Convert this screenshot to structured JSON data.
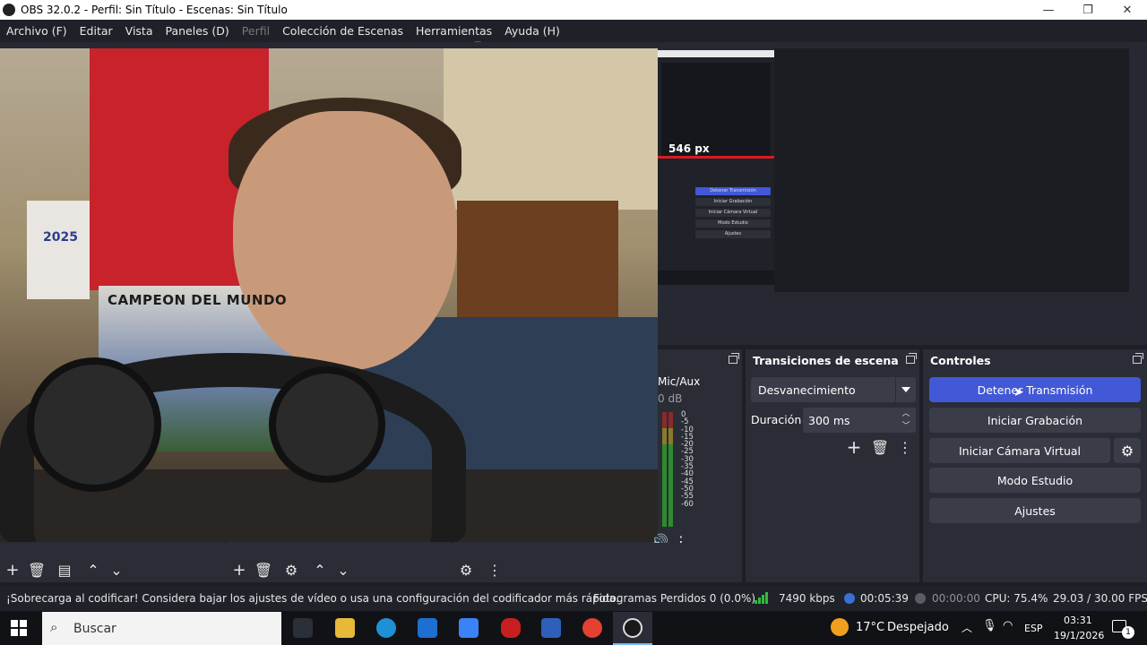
{
  "window": {
    "title": "OBS 32.0.2 - Perfil: Sin Título - Escenas: Sin Título",
    "minimize": "—",
    "restore": "❐",
    "close": "✕"
  },
  "menu": [
    {
      "label": "Archivo (F)",
      "enabled": true
    },
    {
      "label": "Editar",
      "enabled": true
    },
    {
      "label": "Vista",
      "enabled": true
    },
    {
      "label": "Paneles (D)",
      "enabled": true
    },
    {
      "label": "Perfil",
      "enabled": false
    },
    {
      "label": "Colección de Escenas",
      "enabled": true
    },
    {
      "label": "Herramientas",
      "enabled": true
    },
    {
      "label": "Ayuda (H)",
      "enabled": true
    }
  ],
  "preview": {
    "webcam_texts": {
      "poster": "CAMPEON DEL MUNDO",
      "calendar": "2025"
    },
    "nested_capture": {
      "size_label": "546 px",
      "buttons": [
        "Detener Transmisión",
        "Iniciar Grabación",
        "Iniciar Cámara Virtual",
        "Modo Estudio",
        "Ajustes"
      ]
    }
  },
  "mixer": {
    "channel": "Mic/Aux",
    "level": "0 dB",
    "scale": [
      "0",
      "-5",
      "-10",
      "-15",
      "-20",
      "-25",
      "-30",
      "-35",
      "-40",
      "-45",
      "-50",
      "-55",
      "-60"
    ]
  },
  "transitions": {
    "title": "Transiciones de escena",
    "selected": "Desvanecimiento",
    "duration_label": "Duración",
    "duration_value": "300 ms"
  },
  "controls": {
    "title": "Controles",
    "stop_stream": "Detener Transmisión",
    "start_recording": "Iniciar Grabación",
    "start_virtual_cam": "Iniciar Cámara Virtual",
    "studio_mode": "Modo Estudio",
    "settings": "Ajustes"
  },
  "status": {
    "warning": "¡Sobrecarga al codificar! Considera bajar los ajustes de vídeo o usa una configuración del codificador más rápida.",
    "dropped_frames": "Fotogramas Perdidos 0 (0.0%)",
    "bitrate": "7490 kbps",
    "stream_time": "00:05:39",
    "record_time": "00:00:00",
    "cpu": "CPU: 75.4%",
    "fps": "29.03 / 30.00 FPS"
  },
  "taskbar": {
    "search_placeholder": "Buscar",
    "weather_temp": "17°C",
    "weather_desc": "Despejado",
    "language": "ESP",
    "time": "03:31",
    "date": "19/1/2026",
    "notifications": "1"
  },
  "colors": {
    "accent": "#4258d6",
    "panel": "#2a2d35",
    "status_green": "#2fbf3a",
    "stream_blue": "#3b6fd8"
  }
}
